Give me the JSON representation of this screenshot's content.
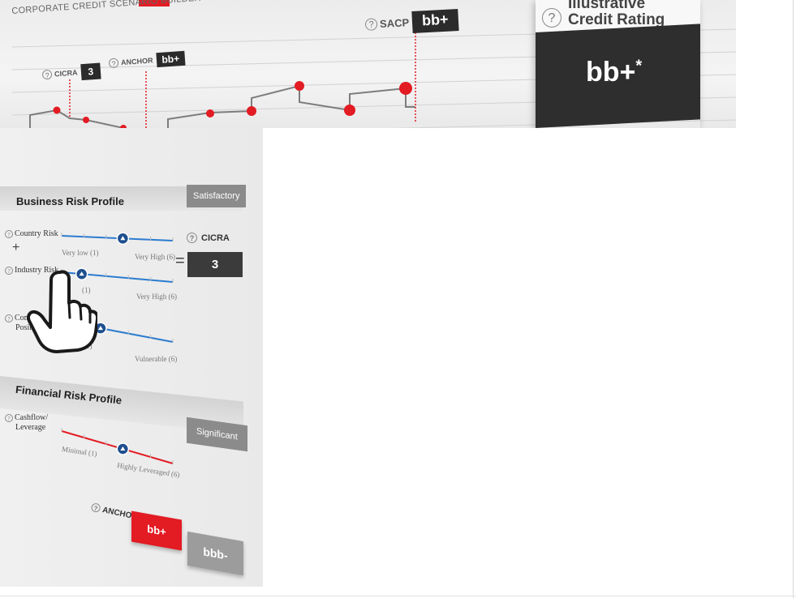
{
  "app": {
    "title": "CORPORATE CREDIT SCENARIO BUILDER"
  },
  "chart_tags": {
    "cicra": {
      "label": "CICRA",
      "value": "3"
    },
    "anchor": {
      "label": "ANCHOR",
      "value": "bb+"
    },
    "sacp": {
      "label": "SACP",
      "value": "bb+"
    }
  },
  "rating_card": {
    "title_line1": "Illustrative",
    "title_line2": "Credit Rating",
    "value": "bb+",
    "value_mark": "*"
  },
  "business_risk": {
    "title": "Business Risk Profile",
    "badge": "Satisfactory",
    "factors": [
      {
        "label": "Country Risk",
        "low": "Very low (1)",
        "high": "Very High (6)",
        "level": 0.55
      },
      {
        "label": "Industry Risk",
        "low": "(1)",
        "high": "Very High (6)",
        "level": 0.18
      },
      {
        "label_line1": "Compe",
        "label_line2": "Positio",
        "low": "(1)",
        "high": "Vulnerable (6)",
        "level": 0.35
      }
    ],
    "plus_symbol": "+",
    "equals_symbol": "=",
    "cicra_label": "CICRA",
    "cicra_value": "3"
  },
  "financial_risk": {
    "title": "Financial Risk Profile",
    "badge": "Significant",
    "factors": [
      {
        "label_line1": "Cashflow/",
        "label_line2": "Leverage",
        "low": "Minimal (1)",
        "high": "Highly Leveraged (6)",
        "level": 0.55
      }
    ],
    "anchor_label": "ANCHOR",
    "anchor_value": "bb+",
    "alt_value": "bbb-"
  },
  "help_icon": "?",
  "icons": [
    "question-circle-icon",
    "hand-pointer-icon",
    "slider-handle-icon"
  ],
  "colors": {
    "accent_red": "#e31b23",
    "dark": "#2e2e2e",
    "slider_blue": "#2b7ccf",
    "handle_blue": "#1e4f8f",
    "badge_grey": "#8b8b8b"
  }
}
